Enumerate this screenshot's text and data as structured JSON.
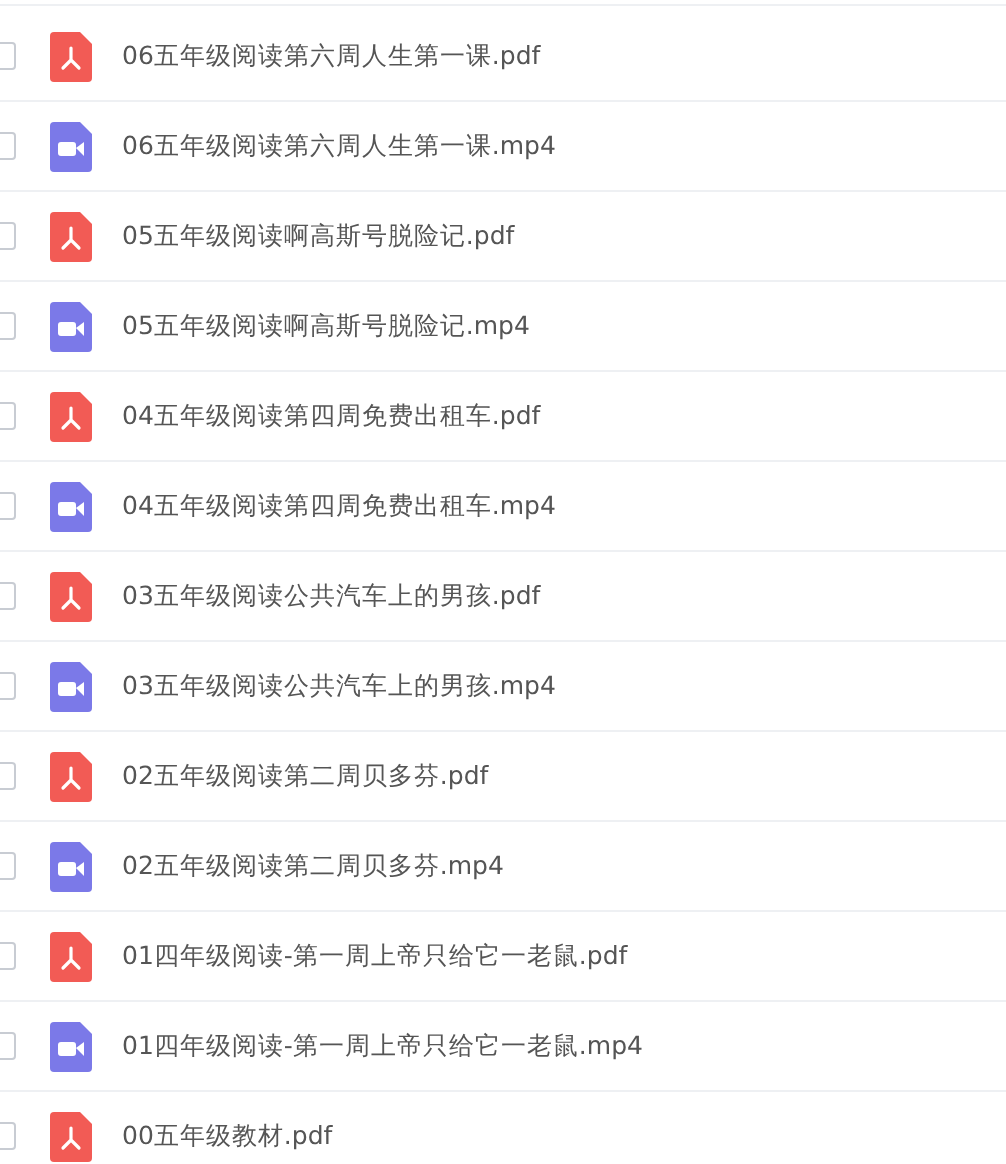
{
  "files": [
    {
      "kind": "pdf",
      "name": "06五年级阅读第六周人生第一课.pdf",
      "checked": false
    },
    {
      "kind": "video",
      "name": "06五年级阅读第六周人生第一课.mp4",
      "checked": false
    },
    {
      "kind": "pdf",
      "name": "05五年级阅读啊高斯号脱险记.pdf",
      "checked": false
    },
    {
      "kind": "video",
      "name": "05五年级阅读啊高斯号脱险记.mp4",
      "checked": false
    },
    {
      "kind": "pdf",
      "name": "04五年级阅读第四周免费出租车.pdf",
      "checked": false
    },
    {
      "kind": "video",
      "name": "04五年级阅读第四周免费出租车.mp4",
      "checked": false
    },
    {
      "kind": "pdf",
      "name": "03五年级阅读公共汽车上的男孩.pdf",
      "checked": false
    },
    {
      "kind": "video",
      "name": "03五年级阅读公共汽车上的男孩.mp4",
      "checked": false
    },
    {
      "kind": "pdf",
      "name": "02五年级阅读第二周贝多芬.pdf",
      "checked": false
    },
    {
      "kind": "video",
      "name": "02五年级阅读第二周贝多芬.mp4",
      "checked": false
    },
    {
      "kind": "pdf",
      "name": "01四年级阅读-第一周上帝只给它一老鼠.pdf",
      "checked": false
    },
    {
      "kind": "video",
      "name": "01四年级阅读-第一周上帝只给它一老鼠.mp4",
      "checked": false
    },
    {
      "kind": "pdf",
      "name": "00五年级教材.pdf",
      "checked": false
    }
  ]
}
